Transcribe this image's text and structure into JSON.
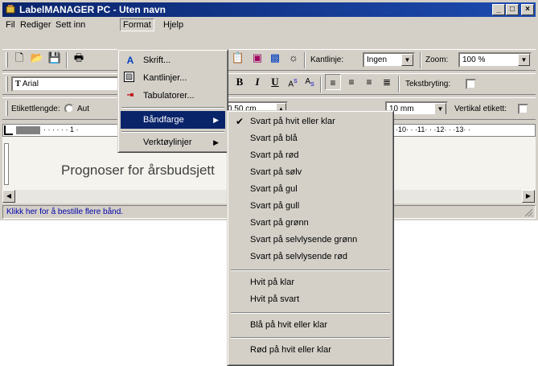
{
  "window": {
    "title": "LabelMANAGER PC - Uten navn"
  },
  "menubar": {
    "items": [
      "Fil",
      "Rediger",
      "Sett inn",
      "Format",
      "Hjelp"
    ]
  },
  "toolbar1": {
    "border_label": "Kantlinje:",
    "border_value": "Ingen",
    "zoom_label": "Zoom:",
    "zoom_value": "100 %"
  },
  "toolbar2": {
    "font_value": "Arial",
    "wrap_label": "Tekstbryting:"
  },
  "toolbar3": {
    "length_label": "Etikettlengde:",
    "auto_text": "Aut",
    "length_value": "0,50 cm",
    "margin_value": "10 mm",
    "vertical_label": "Vertikal etikett:"
  },
  "ruler": {
    "left_ticks": "· · · · · · 1 ·",
    "right_ticks": "·10· · ·11· · ·12· · ·13· ·"
  },
  "document": {
    "label_text": "Prognoser for årsbudsjett"
  },
  "statusbar": {
    "text": "Klikk her for å bestille flere bånd."
  },
  "format_menu": {
    "items": [
      "Skrift...",
      "Kantlinjer...",
      "Tabulatorer...",
      "Båndfarge",
      "Verktøylinjer"
    ]
  },
  "tape_menu": {
    "items": [
      "Svart på hvit eller klar",
      "Svart på blå",
      "Svart på rød",
      "Svart på sølv",
      "Svart på gul",
      "Svart på gull",
      "Svart på grønn",
      "Svart på selvlysende grønn",
      "Svart på selvlysende rød",
      "Hvit på klar",
      "Hvit på svart",
      "Blå på hvit eller klar",
      "Rød på hvit eller klar"
    ],
    "checked_index": 0
  },
  "colors": {
    "title_bar": "#0a246a",
    "highlight": "#0a246a",
    "chrome": "#d4d0c8",
    "status_link": "#0000aa"
  }
}
